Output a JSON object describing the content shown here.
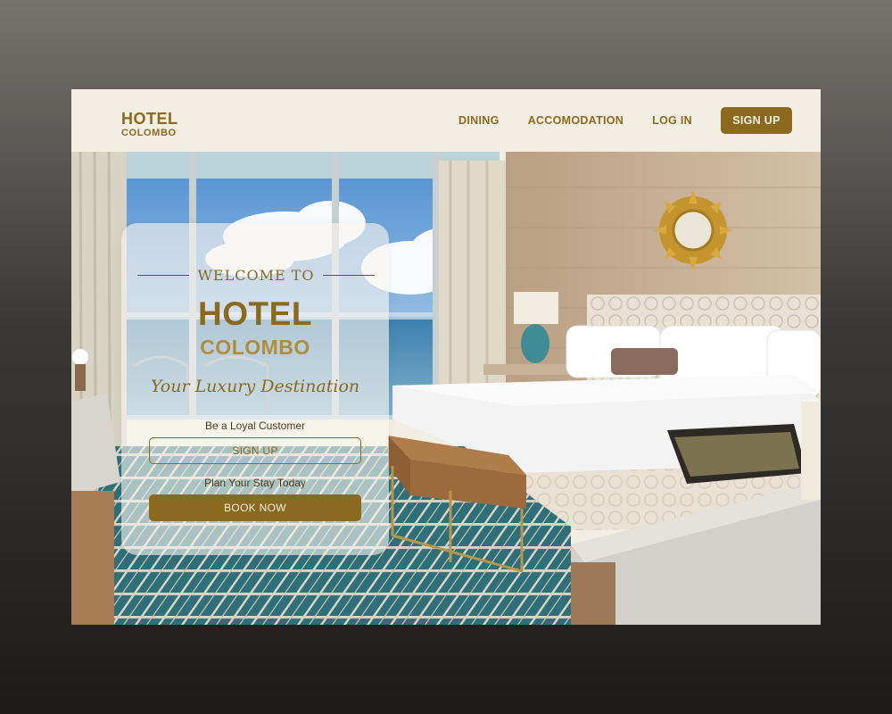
{
  "brand": {
    "line1": "HOTEL",
    "line2": "COLOMBO"
  },
  "nav": {
    "links": [
      {
        "label": "DINING"
      },
      {
        "label": "ACCOMODATION"
      },
      {
        "label": "LOG IN"
      }
    ],
    "signup_label": "SIGN UP"
  },
  "hero": {
    "welcome": "WELCOME TO",
    "title_line1": "HOTEL",
    "title_line2": "COLOMBO",
    "tagline": "Your Luxury Destination",
    "loyal_caption": "Be a Loyal Customer",
    "signup_label": "SIGN UP",
    "plan_caption": "Plan Your Stay Today",
    "book_label": "BOOK NOW"
  },
  "colors": {
    "accent": "#8b6a1f",
    "header_bg": "#f2eee3",
    "page_bg_top": "#77736f",
    "page_bg_bottom": "#1c1b1a"
  }
}
